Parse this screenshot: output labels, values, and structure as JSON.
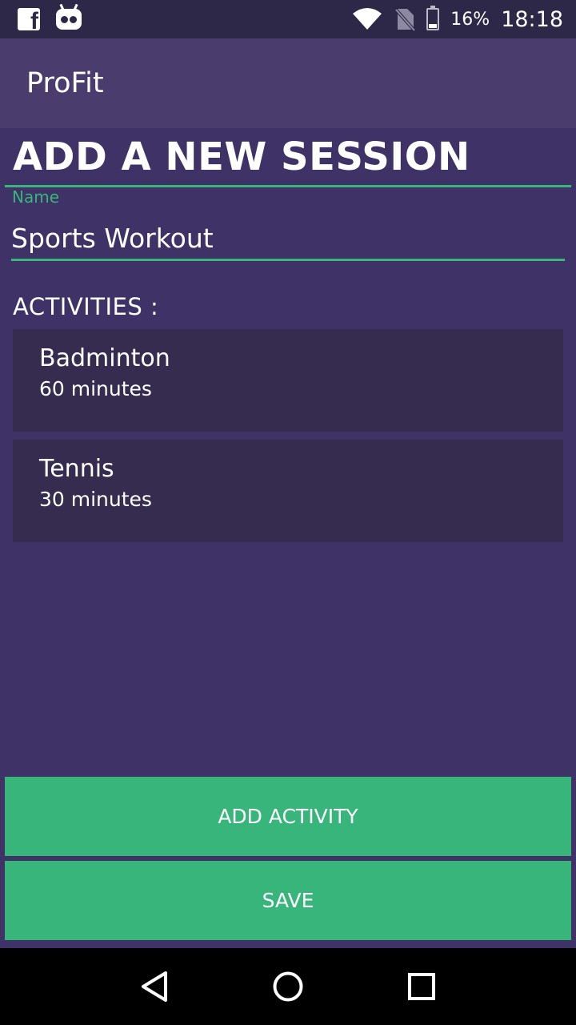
{
  "status_bar": {
    "battery_percent": "16%",
    "time": "18:18",
    "icons": [
      "facebook-icon",
      "robot-icon",
      "wifi-icon",
      "no-sim-icon",
      "battery-icon"
    ]
  },
  "app_bar": {
    "title": "ProFit"
  },
  "form": {
    "title": "ADD A NEW SESSION",
    "name_label": "Name",
    "name_value": "Sports Workout",
    "activities_label": "ACTIVITIES :"
  },
  "activities": [
    {
      "name": "Badminton",
      "duration": "60 minutes"
    },
    {
      "name": "Tennis",
      "duration": "30 minutes"
    }
  ],
  "buttons": {
    "add_activity": "ADD ACTIVITY",
    "save": "SAVE"
  },
  "nav": {
    "icons": [
      "back-icon",
      "home-icon",
      "recents-icon"
    ]
  },
  "colors": {
    "background": "#3e3266",
    "app_bar": "#4a3d6e",
    "status_bar": "#2e2848",
    "card": "#352c4f",
    "accent": "#38b57a"
  }
}
